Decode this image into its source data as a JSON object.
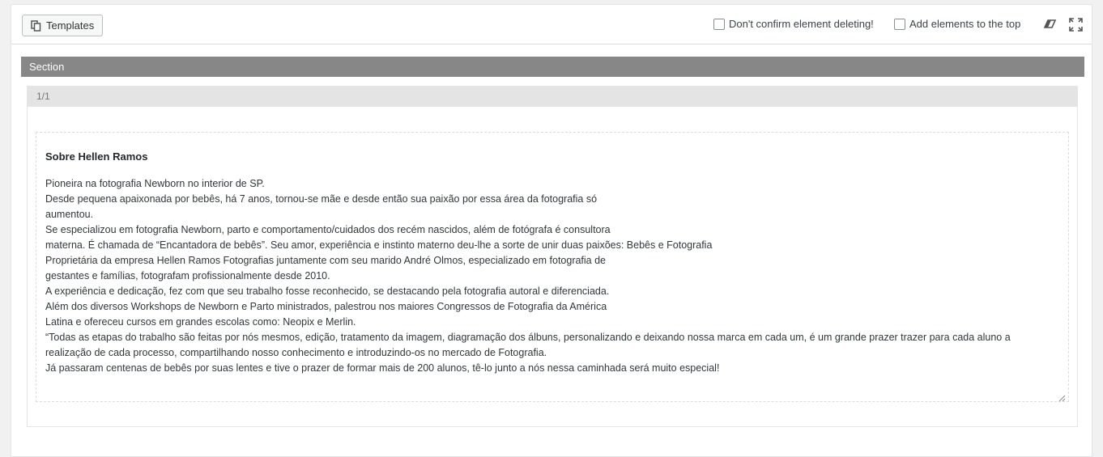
{
  "toolbar": {
    "templates_label": "Templates",
    "options": [
      {
        "label": "Don't confirm element deleting!",
        "checked": false
      },
      {
        "label": "Add elements to the top",
        "checked": false
      }
    ],
    "icons": [
      "templates-icon",
      "eraser-icon",
      "fullscreen-icon"
    ]
  },
  "section": {
    "label": "Section",
    "column": {
      "label": "1/1",
      "element": {
        "title": "Sobre Hellen Ramos",
        "lines": [
          "Pioneira na fotografia Newborn no interior de SP.",
          "Desde pequena apaixonada por bebês, há 7 anos, tornou-se mãe e desde então sua paixão por essa área da fotografia só",
          "aumentou.",
          "Se especializou em fotografia Newborn, parto e comportamento/cuidados dos recém nascidos, além de fotógrafa é consultora",
          "materna. É chamada de “Encantadora de bebês”. Seu amor, experiência e instinto materno deu-lhe a sorte de unir duas paixões: Bebês e Fotografia",
          "Proprietária da empresa Hellen Ramos Fotografias juntamente com seu marido André Olmos, especializado em fotografia de",
          "gestantes e famílias, fotografam profissionalmente desde 2010.",
          "A experiência e dedicação, fez com que seu trabalho fosse reconhecido, se destacando pela fotografia autoral e diferenciada.",
          "Além dos diversos Workshops de Newborn e Parto ministrados, palestrou nos maiores Congressos de Fotografia da América",
          "Latina e ofereceu cursos em grandes escolas como: Neopix e Merlin.",
          "“Todas as etapas do trabalho são feitas por nós mesmos, edição, tratamento da imagem, diagramação dos álbuns, personalizando e deixando nossa marca em cada um, é um grande prazer trazer para cada aluno a",
          "realização de cada processo, compartilhando nosso conhecimento e introduzindo-os no mercado de Fotografia.",
          "Já passaram centenas de bebês por suas lentes e tive o prazer de formar mais de 200 alunos, tê-lo junto a nós nessa caminhada será muito especial!"
        ]
      }
    }
  },
  "colors": {
    "section_bar": "#878787",
    "column_head": "#e4e4e4",
    "panel_bg": "#ffffff",
    "page_bg": "#f1f1f1"
  }
}
